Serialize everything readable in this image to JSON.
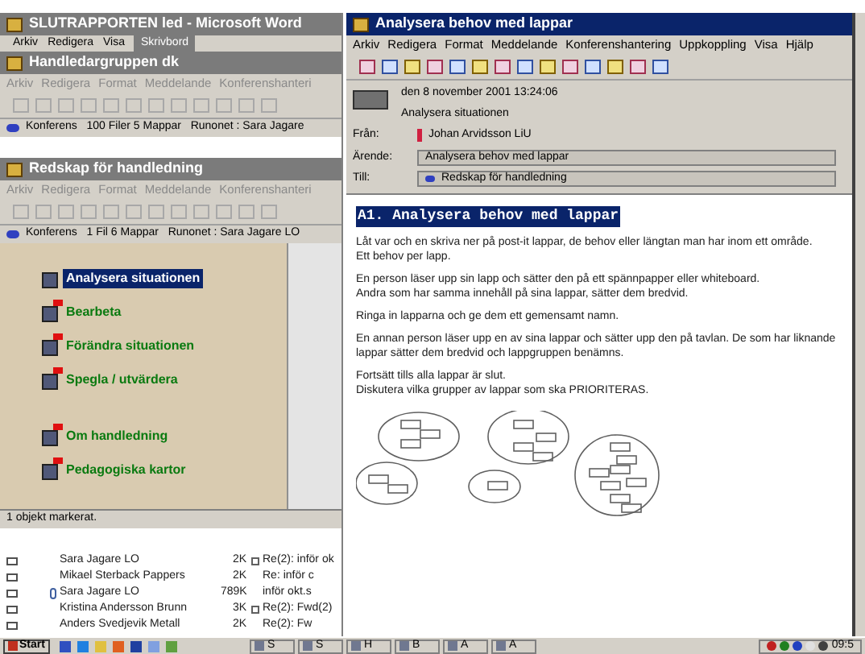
{
  "word_window": {
    "title": "SLUTRAPPORTEN led - Microsoft Word",
    "menu": [
      "Arkiv",
      "Redigera",
      "Visa"
    ],
    "overlapped_title": "Skrivbord"
  },
  "conference_window": {
    "title": "Handledargruppen dk",
    "menu": [
      "Arkiv",
      "Redigera",
      "Format",
      "Meddelande",
      "Konferenshanteri"
    ],
    "status": "Konferens   100 Filer 5 Mappar   Runonet : Sara Jagare"
  },
  "tools_window": {
    "title": "Redskap för handledning",
    "menu": [
      "Arkiv",
      "Redigera",
      "Format",
      "Meddelande",
      "Konferenshanteri"
    ],
    "status": "Konferens   1 Fil 6 Mappar   Runonet : Sara Jagare LO",
    "items": [
      {
        "label": "Analysera situationen",
        "selected": true,
        "flagged": false
      },
      {
        "label": "Bearbeta",
        "selected": false,
        "flagged": true
      },
      {
        "label": "Förändra situationen",
        "selected": false,
        "flagged": true
      },
      {
        "label": "Spegla / utvärdera",
        "selected": false,
        "flagged": true
      },
      {
        "label": "Om handledning",
        "selected": false,
        "flagged": true
      },
      {
        "label": "Pedagogiska kartor",
        "selected": false,
        "flagged": true
      }
    ],
    "status_bar": "1 objekt markerat."
  },
  "mail_list": [
    {
      "sender": "Sara Jagare LO",
      "size": "2K",
      "subject": "Re(2): inför ok",
      "attachment": false,
      "thread": true
    },
    {
      "sender": "Mikael Sterback Pappers",
      "size": "2K",
      "subject": "Re: inför c",
      "attachment": false,
      "thread": false
    },
    {
      "sender": "Sara Jagare LO",
      "size": "789K",
      "subject": "inför okt.s",
      "attachment": true,
      "thread": false
    },
    {
      "sender": "Kristina Andersson Brunn",
      "size": "3K",
      "subject": "Re(2): Fwd(2)",
      "attachment": false,
      "thread": true
    },
    {
      "sender": "Anders Svedjevik Metall",
      "size": "2K",
      "subject": "Re(2): Fw",
      "attachment": false,
      "thread": false
    }
  ],
  "message_window": {
    "title": "Analysera behov med lappar",
    "menu": [
      "Arkiv",
      "Redigera",
      "Format",
      "Meddelande",
      "Konferenshantering",
      "Uppkoppling",
      "Visa",
      "Hjälp"
    ],
    "date": "den 8 november 2001 13:24:06",
    "context": "Analysera situationen",
    "from_label": "Från:",
    "from": "Johan Arvidsson LiU",
    "subject_label": "Ärende:",
    "subject": "Analysera behov med lappar",
    "to_label": "Till:",
    "to": "Redskap för handledning",
    "heading": "A1. Analysera behov med lappar",
    "paragraphs": [
      [
        "Låt var och en skriva ner på post-it lappar, de behov eller längtan man har inom ett område.",
        "Ett behov per lapp."
      ],
      [
        "En person läser upp sin lapp och sätter den på ett spännpapper eller whiteboard.",
        "Andra som har samma innehåll på sina lappar, sätter dem bredvid."
      ],
      [
        "Ringa in lapparna och ge dem ett gemensamt namn."
      ],
      [
        "En annan person läser upp en av sina lappar och sätter upp den på tavlan. De som har liknande lappar sätter dem bredvid och lappgruppen benämns."
      ],
      [
        "Fortsätt tills alla lappar är slut.",
        "Diskutera vilka grupper av lappar som ska PRIORITERAS."
      ]
    ]
  },
  "taskbar": {
    "start": "Start",
    "buttons": [
      "S",
      "S",
      "H",
      "B",
      "A",
      "A"
    ],
    "clock": "09:5"
  }
}
